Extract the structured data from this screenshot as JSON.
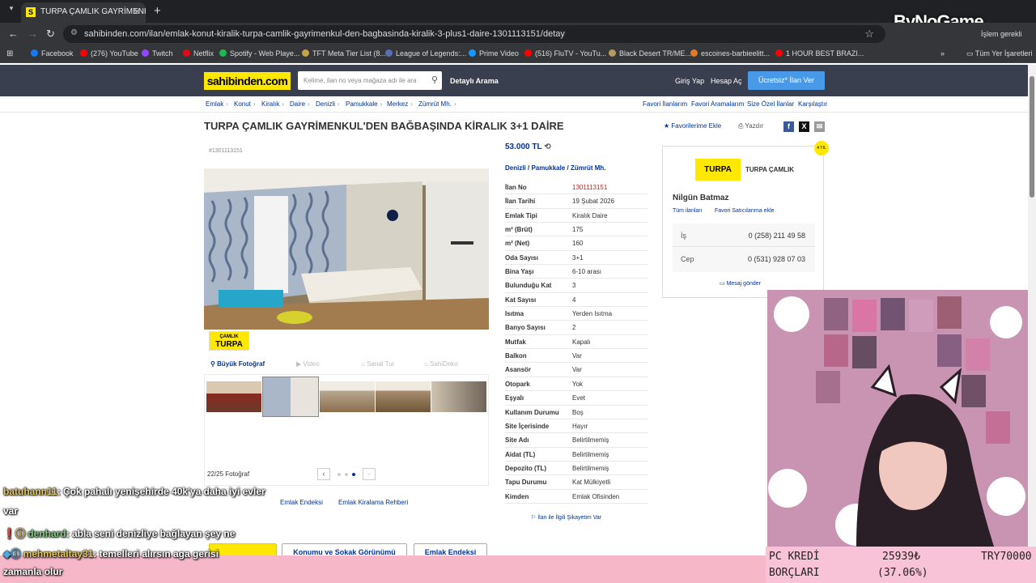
{
  "browser": {
    "tab_title": "TURPA ÇAMLIK GAYRİMENKUL",
    "tab_favicon": "S",
    "url": "sahibinden.com/ilan/emlak-konut-kiralik-turpa-camlik-gayrimenkul-den-bagbasinda-kiralik-3-plus1-daire-1301113151/detay",
    "bookmarks": [
      {
        "label": "Facebook",
        "color": "#1877f2"
      },
      {
        "label": "(276) YouTube",
        "color": "#ff0000"
      },
      {
        "label": "Twitch",
        "color": "#9146ff"
      },
      {
        "label": "Netflix",
        "color": "#e50914"
      },
      {
        "label": "Spotify - Web Playe...",
        "color": "#1db954"
      },
      {
        "label": "TFT Meta Tier List (8...",
        "color": "#c8a24a"
      },
      {
        "label": "League of Legends:...",
        "color": "#5a6fb0"
      },
      {
        "label": "Prime Video",
        "color": "#1399ff"
      },
      {
        "label": "(516) FluTV - YouTu...",
        "color": "#ff0000"
      },
      {
        "label": "Black Desert TR/ME...",
        "color": "#b89a5a"
      },
      {
        "label": "escoines-barbieelitt...",
        "color": "#e07a2a"
      },
      {
        "label": "1 HOUR BEST BRAZI...",
        "color": "#ff0000"
      }
    ],
    "all_bookmarks": "Tüm Yer İşaretleri",
    "profile_label": "İşlem gerekli"
  },
  "watermark": "ByNoGame",
  "site": {
    "logo": "sahibinden.com",
    "search_placeholder": "Kelime, ilan no veya mağaza adı ile ara",
    "detailed_search": "Detaylı Arama",
    "login": "Giriş Yap",
    "register": "Hesap Aç",
    "post_button": "Ücretsiz* İlan Ver",
    "breadcrumbs": [
      "Emlak",
      "Konut",
      "Kiralık",
      "Daire",
      "Denizli",
      "Pamukkale",
      "Merkez",
      "Zümrüt Mh."
    ],
    "right_links": [
      "Favori İlanlarım",
      "Favori Aramalarım",
      "Size Özel İlanlar",
      "Karşılaştır"
    ]
  },
  "listing": {
    "title": "TURPA ÇAMLIK GAYRİMENKUL'DEN BAĞBAŞINDA KİRALIK 3+1 DAİRE",
    "add_favorite": "Favorilerime Ekle",
    "print": "Yazdır",
    "listing_no_tag": "#1301113151",
    "badge_top": "ÇAMLIK",
    "badge_bottom": "TURPA",
    "media_tabs": [
      "Büyük Fotoğraf",
      "Video",
      "Sanal Tur",
      "SahiDeko"
    ],
    "photo_count": "22/25 Fotoğraf",
    "price": "53.000 TL",
    "location": [
      "Denizli",
      "Pamukkale",
      "Zümrüt Mh."
    ],
    "details": [
      {
        "k": "İlan No",
        "v": "1301113151"
      },
      {
        "k": "İlan Tarihi",
        "v": "19 Şubat 2026"
      },
      {
        "k": "Emlak Tipi",
        "v": "Kiralık Daire"
      },
      {
        "k": "m² (Brüt)",
        "v": "175"
      },
      {
        "k": "m² (Net)",
        "v": "160"
      },
      {
        "k": "Oda Sayısı",
        "v": "3+1"
      },
      {
        "k": "Bina Yaşı",
        "v": "6-10 arası"
      },
      {
        "k": "Bulunduğu Kat",
        "v": "3"
      },
      {
        "k": "Kat Sayısı",
        "v": "4"
      },
      {
        "k": "Isıtma",
        "v": "Yerden Isıtma"
      },
      {
        "k": "Banyo Sayısı",
        "v": "2"
      },
      {
        "k": "Mutfak",
        "v": "Kapalı"
      },
      {
        "k": "Balkon",
        "v": "Var"
      },
      {
        "k": "Asansör",
        "v": "Var"
      },
      {
        "k": "Otopark",
        "v": "Yok"
      },
      {
        "k": "Eşyalı",
        "v": "Evet"
      },
      {
        "k": "Kullanım Durumu",
        "v": "Boş"
      },
      {
        "k": "Site İçerisinde",
        "v": "Hayır"
      },
      {
        "k": "Site Adı",
        "v": "Belirtilmemiş"
      },
      {
        "k": "Aidat (TL)",
        "v": "Belirtilmemiş"
      },
      {
        "k": "Depozito (TL)",
        "v": "Belirtilmemiş"
      },
      {
        "k": "Tapu Durumu",
        "v": "Kat Mülkiyetli"
      },
      {
        "k": "Kimden",
        "v": "Emlak Ofisinden"
      }
    ],
    "complain": "İlan ile İlgili Şikayetim Var",
    "bottom_links": [
      "Emlak Endeksi",
      "Emlak Kiralama Rehberi"
    ],
    "bottom_buttons": [
      "Konumu ve Sokak Görünümü",
      "Emlak Endeksi"
    ]
  },
  "seller": {
    "logo": "TURPA",
    "name": "TURPA ÇAMLIK",
    "agent": "Nilgün Batmaz",
    "all_listings": "Tüm ilanları",
    "add_fav_seller": "Favori Satıcılarıma ekle",
    "phones": [
      {
        "k": "İş",
        "v": "0 (258) 211 49 58"
      },
      {
        "k": "Cep",
        "v": "0 (531) 928 07 03"
      }
    ],
    "message": "Mesaj gönder",
    "badge": "4 YIL"
  },
  "chat": [
    {
      "user": "batuhann11",
      "text": ": Çok pahalı yenişehirde 40k'ya daha iyi evler"
    },
    {
      "user": "",
      "text": "var"
    },
    {
      "user": "denhard",
      "text": ": abla seni denizliye bağlayan şey ne"
    },
    {
      "user": "mehmetaltay31",
      "text": ": temelleri alırsın aga gerisi"
    },
    {
      "user": "",
      "text": "zamanla olur"
    }
  ],
  "stream_stats": {
    "line1_label": "PC KREDİ",
    "line2_label": "BORÇLARI",
    "amount": "25939₺",
    "percent": "(37.06%)",
    "target": "TRY70000"
  }
}
